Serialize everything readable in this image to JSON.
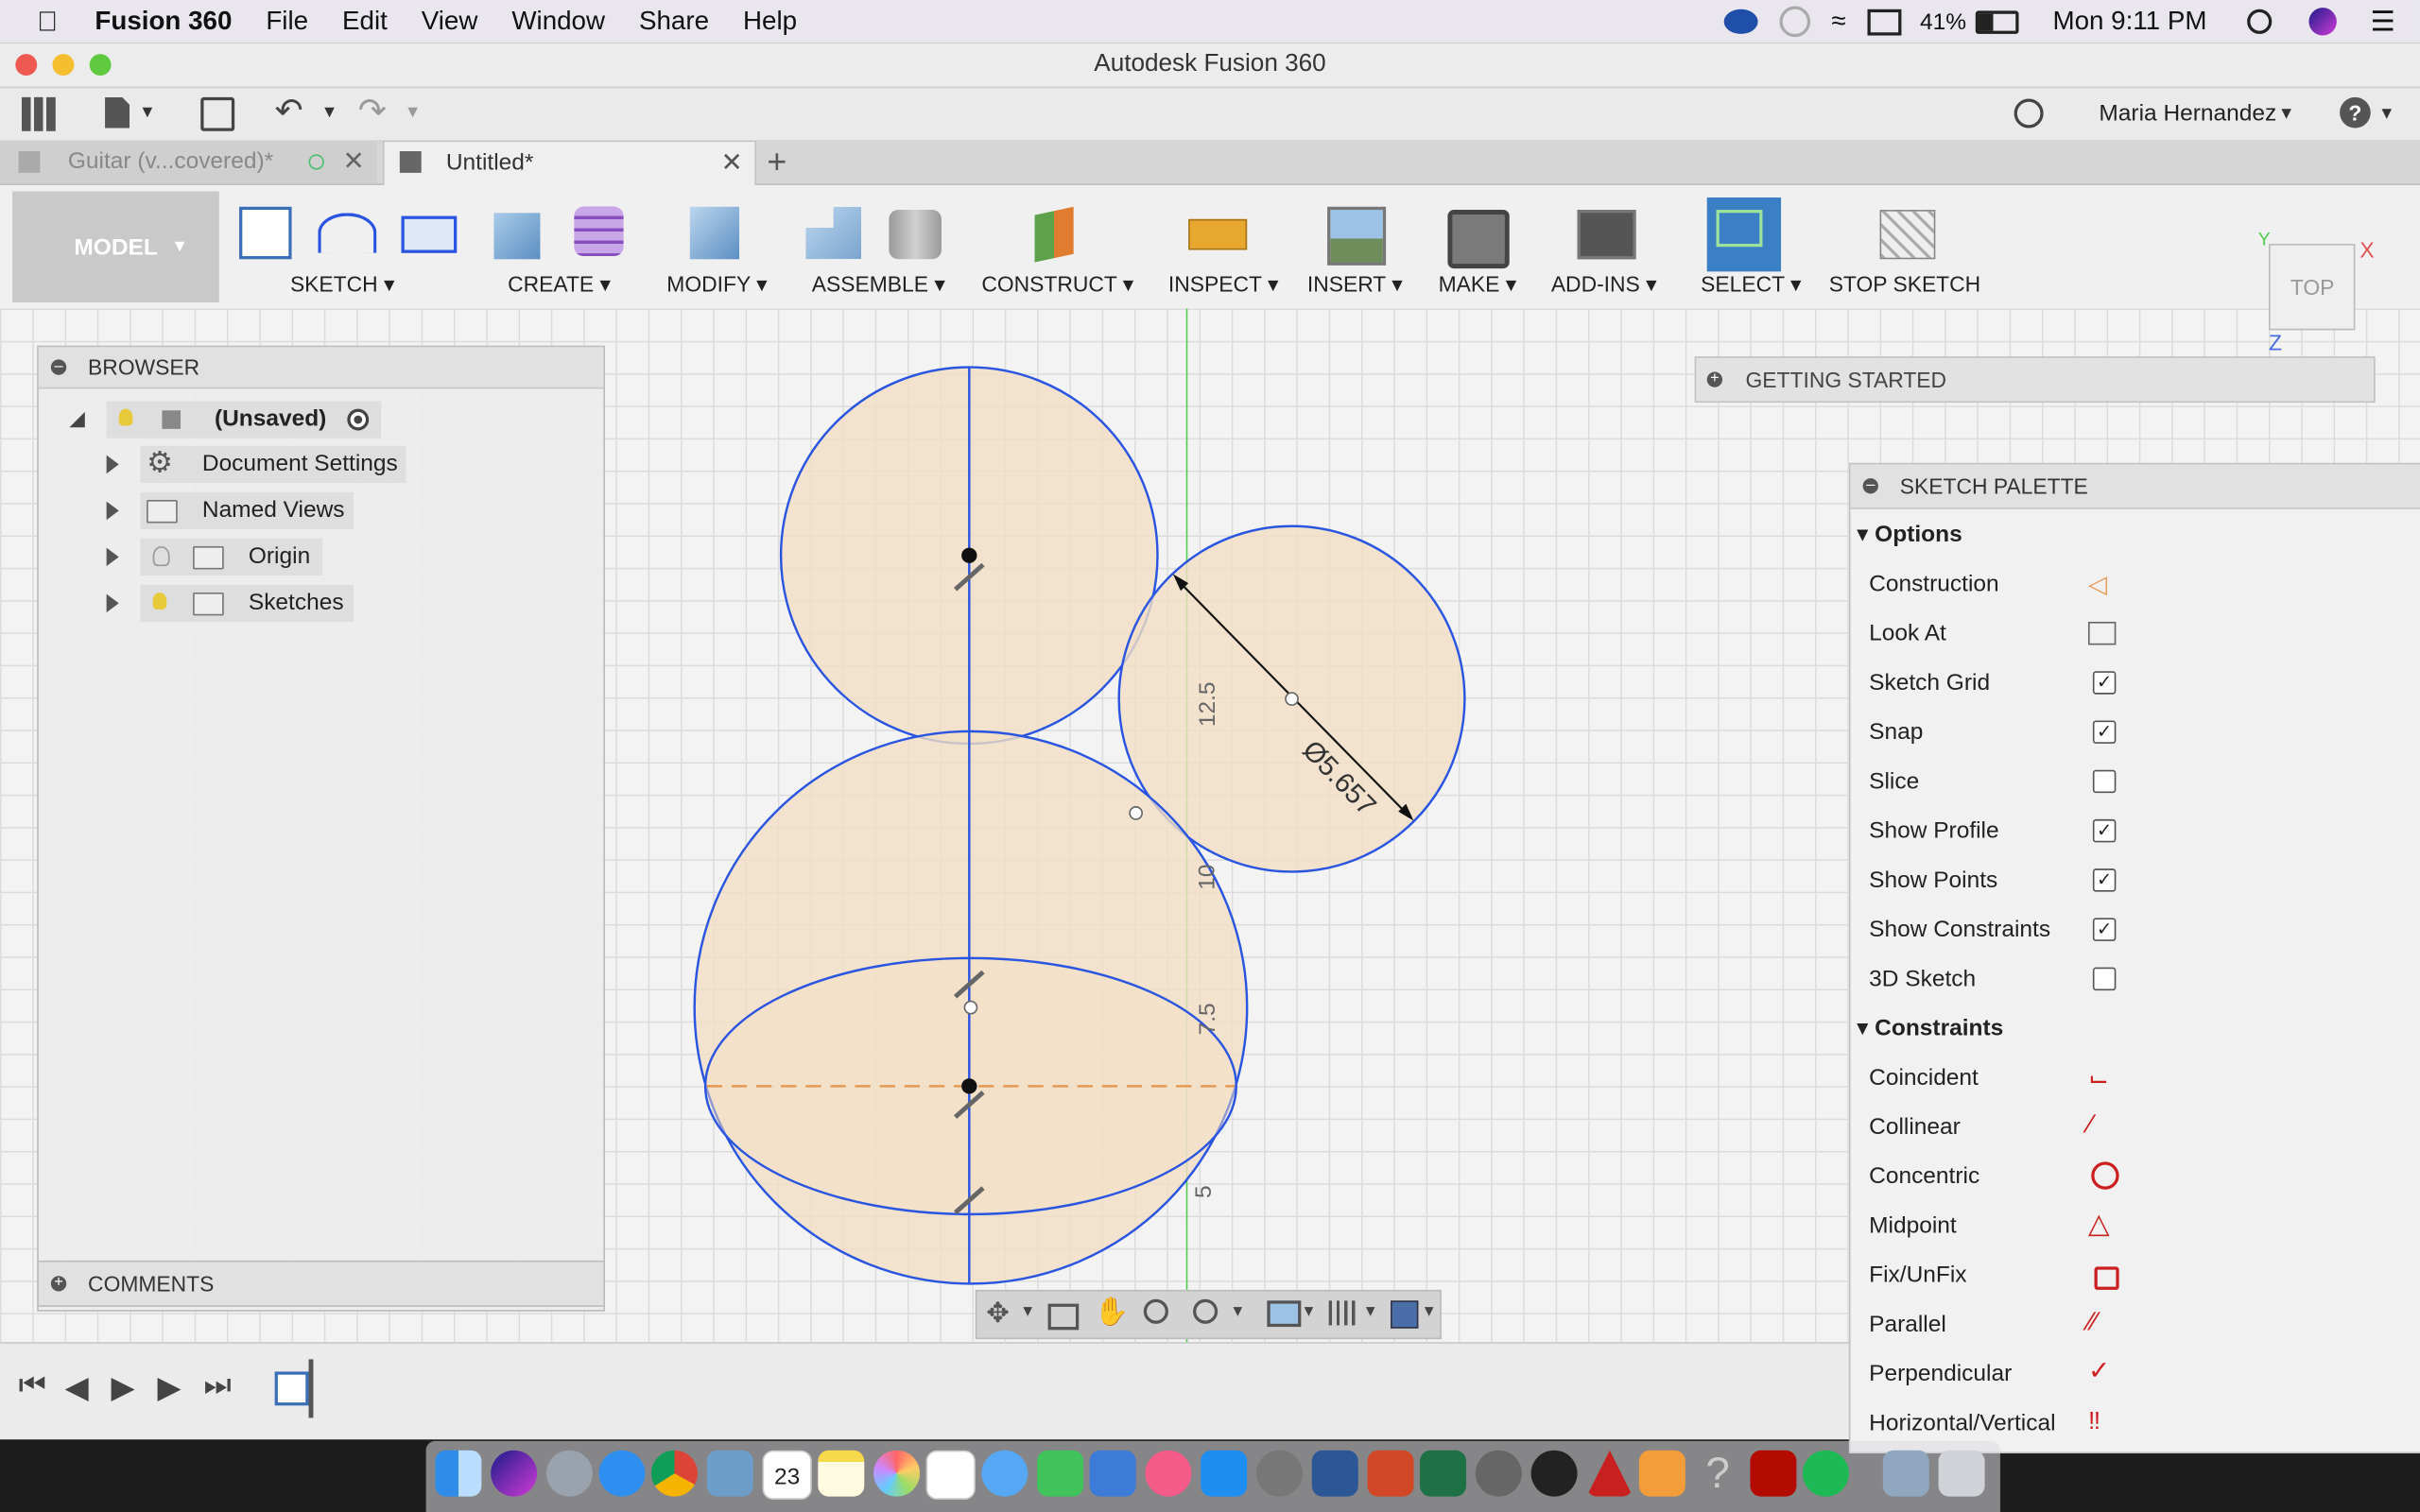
{
  "menubar": {
    "app_name": "Fusion 360",
    "items": [
      "File",
      "Edit",
      "View",
      "Window",
      "Share",
      "Help"
    ],
    "battery": "41%",
    "clock": "Mon 9:11 PM"
  },
  "window": {
    "title": "Autodesk Fusion 360"
  },
  "quickbar": {
    "user": "Maria Hernandez"
  },
  "tabs": [
    {
      "label": "Guitar (v...covered)*"
    },
    {
      "label": "Untitled*"
    }
  ],
  "ribbon": {
    "workspace": "MODEL",
    "groups": [
      "SKETCH",
      "CREATE",
      "MODIFY",
      "ASSEMBLE",
      "CONSTRUCT",
      "INSPECT",
      "INSERT",
      "MAKE",
      "ADD-INS",
      "SELECT",
      "STOP SKETCH"
    ]
  },
  "browser": {
    "header": "BROWSER",
    "root": "(Unsaved)",
    "nodes": [
      "Document Settings",
      "Named Views",
      "Origin",
      "Sketches"
    ],
    "comments": "COMMENTS"
  },
  "getting_started": "GETTING STARTED",
  "viewcube": {
    "face": "TOP",
    "axis_x": "X",
    "axis_y": "Y",
    "axis_z": "Z"
  },
  "sketch": {
    "dimension_diameter": "Ø5.657",
    "ruler_labels": [
      "12.5",
      "10",
      "7.5",
      "5"
    ]
  },
  "palette": {
    "header": "SKETCH PALETTE",
    "options_title": "Options",
    "options": [
      {
        "label": "Construction",
        "type": "icon",
        "icon": "construction-icon"
      },
      {
        "label": "Look At",
        "type": "icon",
        "icon": "look-at-icon"
      },
      {
        "label": "Sketch Grid",
        "type": "check",
        "checked": true
      },
      {
        "label": "Snap",
        "type": "check",
        "checked": true
      },
      {
        "label": "Slice",
        "type": "check",
        "checked": false
      },
      {
        "label": "Show Profile",
        "type": "check",
        "checked": true
      },
      {
        "label": "Show Points",
        "type": "check",
        "checked": true
      },
      {
        "label": "Show Constraints",
        "type": "check",
        "checked": true
      },
      {
        "label": "3D Sketch",
        "type": "check",
        "checked": false
      }
    ],
    "constraints_title": "Constraints",
    "constraints": [
      {
        "label": "Coincident",
        "icon": "coincident-icon"
      },
      {
        "label": "Collinear",
        "icon": "collinear-icon"
      },
      {
        "label": "Concentric",
        "icon": "concentric-icon"
      },
      {
        "label": "Midpoint",
        "icon": "midpoint-icon"
      },
      {
        "label": "Fix/UnFix",
        "icon": "lock-icon"
      },
      {
        "label": "Parallel",
        "icon": "parallel-icon"
      },
      {
        "label": "Perpendicular",
        "icon": "perpendicular-icon"
      },
      {
        "label": "Horizontal/Vertical",
        "icon": "horizontal-vertical-icon"
      }
    ]
  },
  "dock": {
    "calendar_day": "23"
  },
  "colors": {
    "sketch_line": "#2a55e0",
    "profile_fill": "#f3dfc4",
    "select_accent": "#3b7fc4",
    "constraint_red": "#cc2020"
  }
}
